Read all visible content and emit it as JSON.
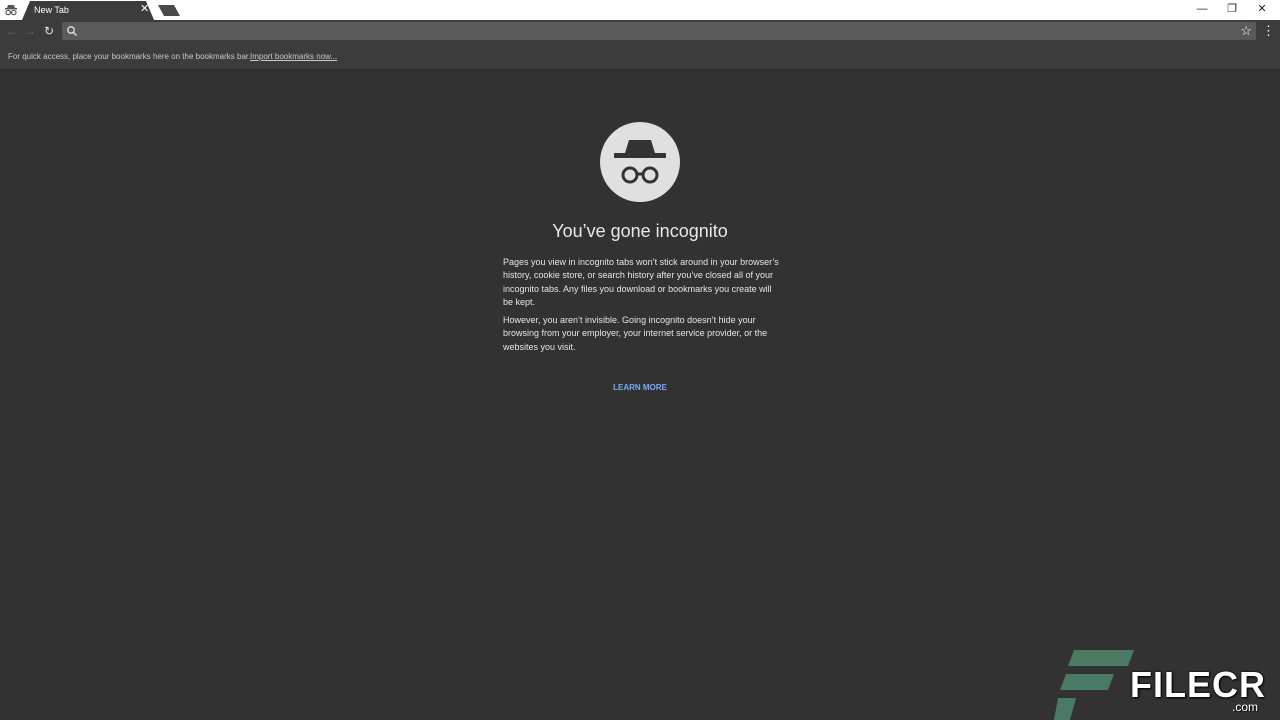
{
  "tab": {
    "title": "New Tab",
    "close_glyph": "✕"
  },
  "window_controls": {
    "minimize": "—",
    "restore": "❐",
    "close": "✕"
  },
  "toolbar": {
    "back_glyph": "←",
    "forward_glyph": "→",
    "reload_glyph": "↻",
    "omnibox_value": "",
    "star_glyph": "☆",
    "menu_glyph": "⋮"
  },
  "bookmarks_bar": {
    "hint": "For quick access, place your bookmarks here on the bookmarks bar.",
    "import_link": "Import bookmarks now..."
  },
  "content": {
    "headline": "You’ve gone incognito",
    "paragraph_1": "Pages you view in incognito tabs won’t stick around in your browser’s history, cookie store, or search history after you’ve closed all of your incognito tabs. Any files you download or bookmarks you create will be kept.",
    "paragraph_2": "However, you aren’t invisible. Going incognito doesn’t hide your browsing from your employer, your internet service provider, or the websites you visit.",
    "learn_more": "LEARN MORE"
  },
  "watermark": {
    "text": "FILECR",
    "sub": ".com"
  },
  "colors": {
    "page_bg": "#323232",
    "toolbar_bg": "#3c3c3c",
    "omnibox_bg": "#5a5a5a",
    "logo_circle": "#e0e0e0",
    "link_blue": "#78aaf5",
    "watermark_green": "#4a7a63"
  },
  "icons": [
    "incognito-icon",
    "search-icon",
    "star-icon",
    "menu-icon",
    "back-icon",
    "forward-icon",
    "reload-icon"
  ]
}
